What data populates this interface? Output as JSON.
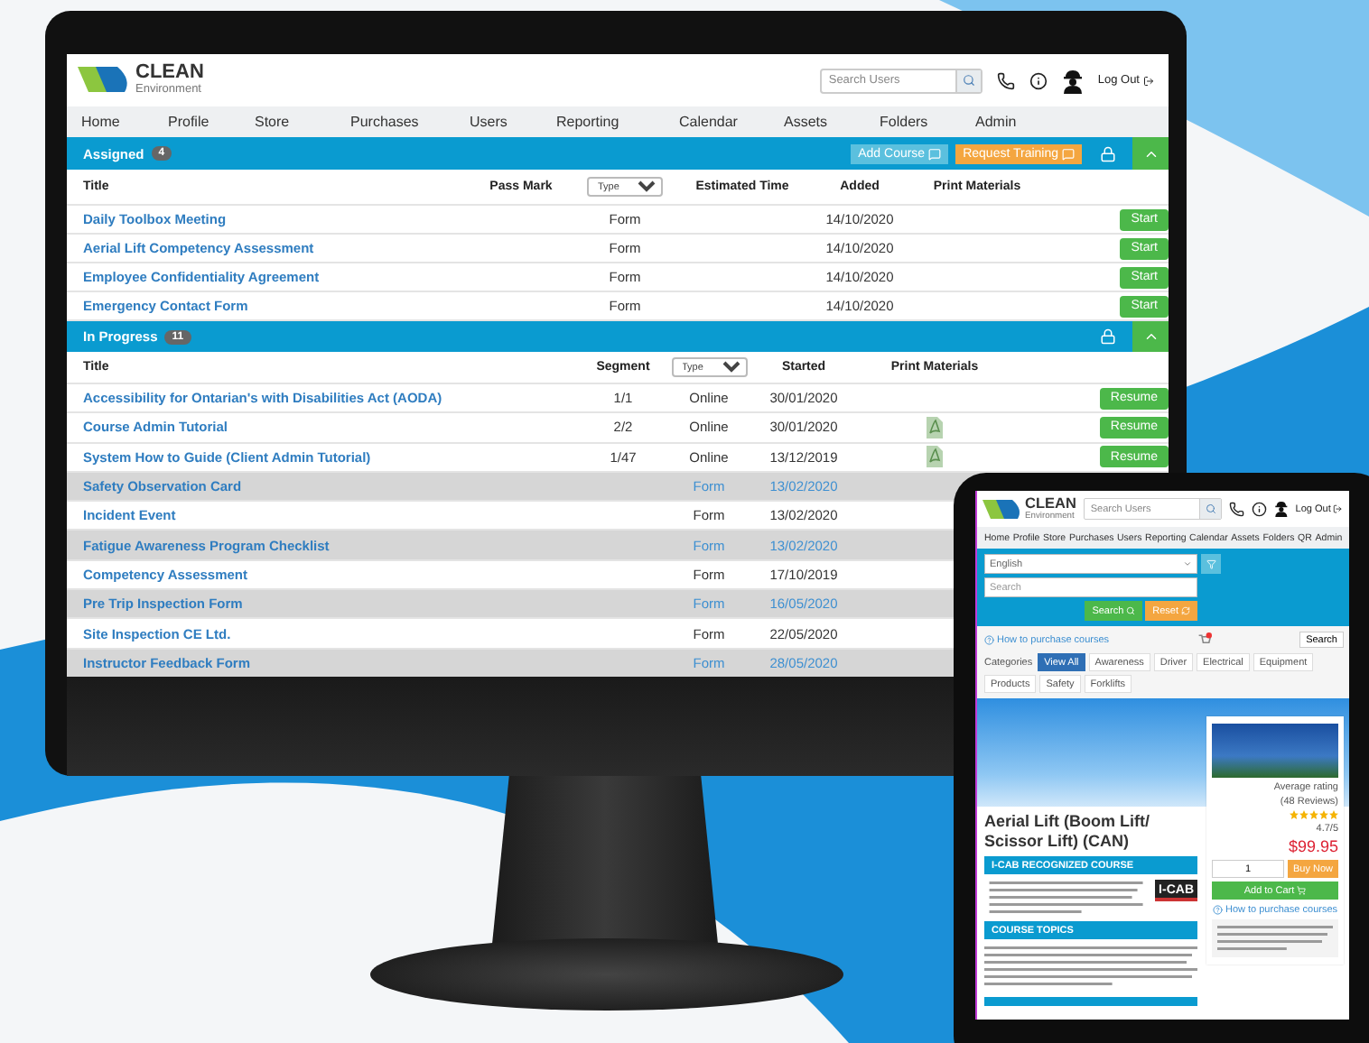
{
  "desktop": {
    "logo": {
      "name": "CLEAN",
      "tagline": "Environment"
    },
    "search": {
      "placeholder": "Search Users"
    },
    "logout": "Log Out",
    "nav": [
      "Home",
      "Profile",
      "Store",
      "Purchases",
      "Users",
      "Reporting",
      "Calendar",
      "Assets",
      "Folders",
      "Admin"
    ],
    "sections": [
      {
        "kind": "assigned",
        "title": "Assigned",
        "count": "4",
        "expanded": true,
        "buttons": [
          {
            "label": "Add Course",
            "kind": "info"
          },
          {
            "label": "Request Training",
            "kind": "warning"
          }
        ],
        "columns": [
          {
            "label": "Title",
            "kind": "text"
          },
          {
            "label": "Pass Mark",
            "kind": "text"
          },
          {
            "label": "Type",
            "kind": "select"
          },
          {
            "label": "Estimated Time",
            "kind": "text"
          },
          {
            "label": "Added",
            "kind": "text"
          },
          {
            "label": "Print Materials",
            "kind": "text"
          }
        ],
        "rows": [
          {
            "title": "Daily Toolbox Meeting",
            "type": "Form",
            "date": "14/10/2020",
            "pdf": false,
            "action": "Start",
            "shaded": false
          },
          {
            "title": "Aerial Lift Competency Assessment",
            "type": "Form",
            "date": "14/10/2020",
            "pdf": false,
            "action": "Start",
            "shaded": false
          },
          {
            "title": "Employee Confidentiality Agreement",
            "type": "Form",
            "date": "14/10/2020",
            "pdf": false,
            "action": "Start",
            "shaded": false
          },
          {
            "title": "Emergency Contact Form",
            "type": "Form",
            "date": "14/10/2020",
            "pdf": false,
            "action": "Start",
            "shaded": false
          }
        ]
      },
      {
        "kind": "in_progress",
        "title": "In Progress",
        "count": "11",
        "expanded": true,
        "columns": [
          {
            "label": "Title",
            "kind": "text"
          },
          {
            "label": "Segment",
            "kind": "text"
          },
          {
            "label": "Type",
            "kind": "select"
          },
          {
            "label": "Started",
            "kind": "text"
          },
          {
            "label": "Print Materials",
            "kind": "text"
          }
        ],
        "rows": [
          {
            "title": "Accessibility for Ontarian's with Disabilities Act (AODA)",
            "segment": "1/1",
            "type": "Online",
            "date": "30/01/2020",
            "pdf": false,
            "action": "Resume",
            "shaded": false
          },
          {
            "title": "Course Admin Tutorial",
            "segment": "2/2",
            "type": "Online",
            "date": "30/01/2020",
            "pdf": true,
            "action": "Resume",
            "shaded": false
          },
          {
            "title": "System How to Guide (Client Admin Tutorial)",
            "segment": "1/47",
            "type": "Online",
            "date": "13/12/2019",
            "pdf": true,
            "action": "Resume",
            "shaded": false
          },
          {
            "title": "Safety Observation Card",
            "type": "Form",
            "date": "13/02/2020",
            "pdf": false,
            "shaded": true
          },
          {
            "title": "Incident Event",
            "type": "Form",
            "date": "13/02/2020",
            "pdf": false,
            "shaded": false
          },
          {
            "title": "Fatigue Awareness Program Checklist",
            "type": "Form",
            "date": "13/02/2020",
            "pdf": false,
            "shaded": true
          },
          {
            "title": "Competency Assessment",
            "type": "Form",
            "date": "17/10/2019",
            "pdf": false,
            "shaded": false
          },
          {
            "title": "Pre Trip Inspection Form",
            "type": "Form",
            "date": "16/05/2020",
            "pdf": false,
            "shaded": true
          },
          {
            "title": "Site Inspection CE Ltd.",
            "type": "Form",
            "date": "22/05/2020",
            "pdf": false,
            "shaded": false
          },
          {
            "title": "Instructor Feedback Form",
            "type": "Form",
            "date": "28/05/2020",
            "pdf": false,
            "shaded": true
          }
        ]
      }
    ]
  },
  "tablet": {
    "logo": {
      "name": "CLEAN",
      "tagline": "Environment"
    },
    "search": {
      "placeholder": "Search Users"
    },
    "logout": "Log Out",
    "nav": [
      "Home",
      "Profile",
      "Store",
      "Purchases",
      "Users",
      "Reporting",
      "Calendar",
      "Assets",
      "Folders",
      "QR",
      "Admin"
    ],
    "filter": {
      "language": "English",
      "search_placeholder": "Search",
      "buttons": [
        {
          "label": "Search",
          "kind": "success"
        },
        {
          "label": "Reset",
          "kind": "warning"
        }
      ]
    },
    "help_link": "How to purchase courses",
    "side_button": "Search",
    "categories_label": "Categories",
    "categories": [
      {
        "label": "View All",
        "selected": true
      },
      {
        "label": "Awareness",
        "selected": false
      },
      {
        "label": "Driver",
        "selected": false
      },
      {
        "label": "Electrical",
        "selected": false
      },
      {
        "label": "Equipment",
        "selected": false
      },
      {
        "label": "Products",
        "selected": false
      },
      {
        "label": "Safety",
        "selected": false
      },
      {
        "label": "Forklifts",
        "selected": false
      }
    ],
    "product": {
      "title": "Aerial Lift (Boom Lift/ Scissor Lift) (CAN)",
      "badge": "I-CAB RECOGNIZED COURSE",
      "logo": "I-CAB",
      "topics_heading": "COURSE TOPICS",
      "rating_label": "Average rating",
      "reviews": "(48 Reviews)",
      "stars": 5,
      "score": "4.7/5",
      "price": "$99.95",
      "quantity": "1",
      "buy": "Buy Now",
      "add_to_cart": "Add to Cart",
      "help_link": "How to purchase courses"
    }
  }
}
